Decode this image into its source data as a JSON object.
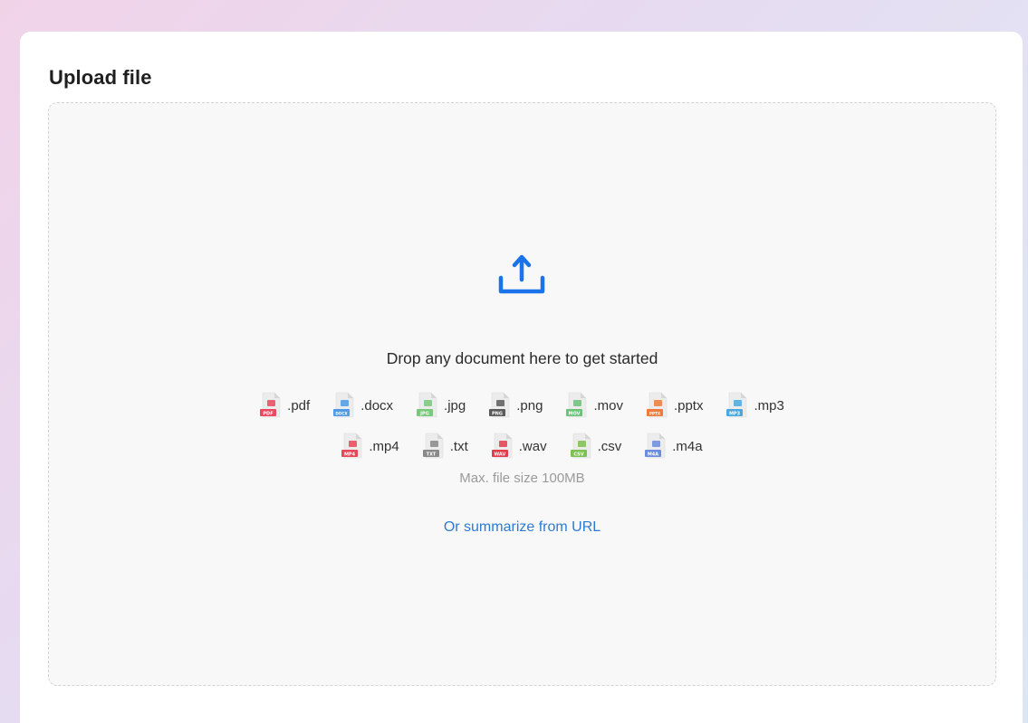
{
  "panel": {
    "title": "Upload file"
  },
  "dropzone": {
    "message": "Drop any document here to get started",
    "max_size": "Max. file size 100MB",
    "url_link": "Or summarize from URL",
    "upload_icon": "upload-icon",
    "accent_color": "#1a73e8"
  },
  "file_types": {
    "row1": [
      {
        "ext": ".pdf",
        "badge": "PDF",
        "color": "#e84a5f",
        "icon": "pdf-file-icon"
      },
      {
        "ext": ".docx",
        "badge": "DOCX",
        "color": "#4f9be8",
        "icon": "docx-file-icon"
      },
      {
        "ext": ".jpg",
        "badge": "JPG",
        "color": "#7ac87a",
        "icon": "jpg-file-icon"
      },
      {
        "ext": ".png",
        "badge": "PNG",
        "color": "#5a5a5a",
        "icon": "png-file-icon"
      },
      {
        "ext": ".mov",
        "badge": "MOV",
        "color": "#6cc27a",
        "icon": "mov-file-icon"
      },
      {
        "ext": ".pptx",
        "badge": "PPTX",
        "color": "#f07a3c",
        "icon": "pptx-file-icon"
      },
      {
        "ext": ".mp3",
        "badge": "MP3",
        "color": "#4aa8e0",
        "icon": "mp3-file-icon"
      }
    ],
    "row2": [
      {
        "ext": ".mp4",
        "badge": "MP4",
        "color": "#e8475a",
        "icon": "mp4-file-icon"
      },
      {
        "ext": ".txt",
        "badge": "TXT",
        "color": "#8a8a8a",
        "icon": "txt-file-icon"
      },
      {
        "ext": ".wav",
        "badge": "WAV",
        "color": "#e53b4b",
        "icon": "wav-file-icon"
      },
      {
        "ext": ".csv",
        "badge": "CSV",
        "color": "#7cc24e",
        "icon": "csv-file-icon"
      },
      {
        "ext": ".m4a",
        "badge": "M4A",
        "color": "#6b8de0",
        "icon": "m4a-file-icon"
      }
    ]
  }
}
